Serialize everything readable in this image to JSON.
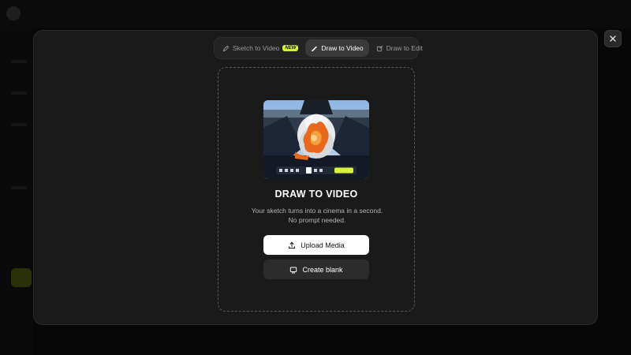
{
  "modal": {
    "tabs": [
      {
        "label": "Sketch to Video",
        "badge": "NEW",
        "icon": "sketch-icon",
        "active": false
      },
      {
        "label": "Draw to Video",
        "icon": "draw-icon",
        "active": true
      },
      {
        "label": "Draw to Edit",
        "icon": "edit-icon",
        "active": false
      }
    ],
    "title": "DRAW TO VIDEO",
    "description": "Your sketch turns into a cinema in a second. No prompt needed.",
    "upload_label": "Upload Media",
    "blank_label": "Create blank",
    "close_icon": "close-icon"
  },
  "colors": {
    "accent": "#d6f23a",
    "modal_bg": "#1a1a1a",
    "primary_button": "#ffffff"
  }
}
